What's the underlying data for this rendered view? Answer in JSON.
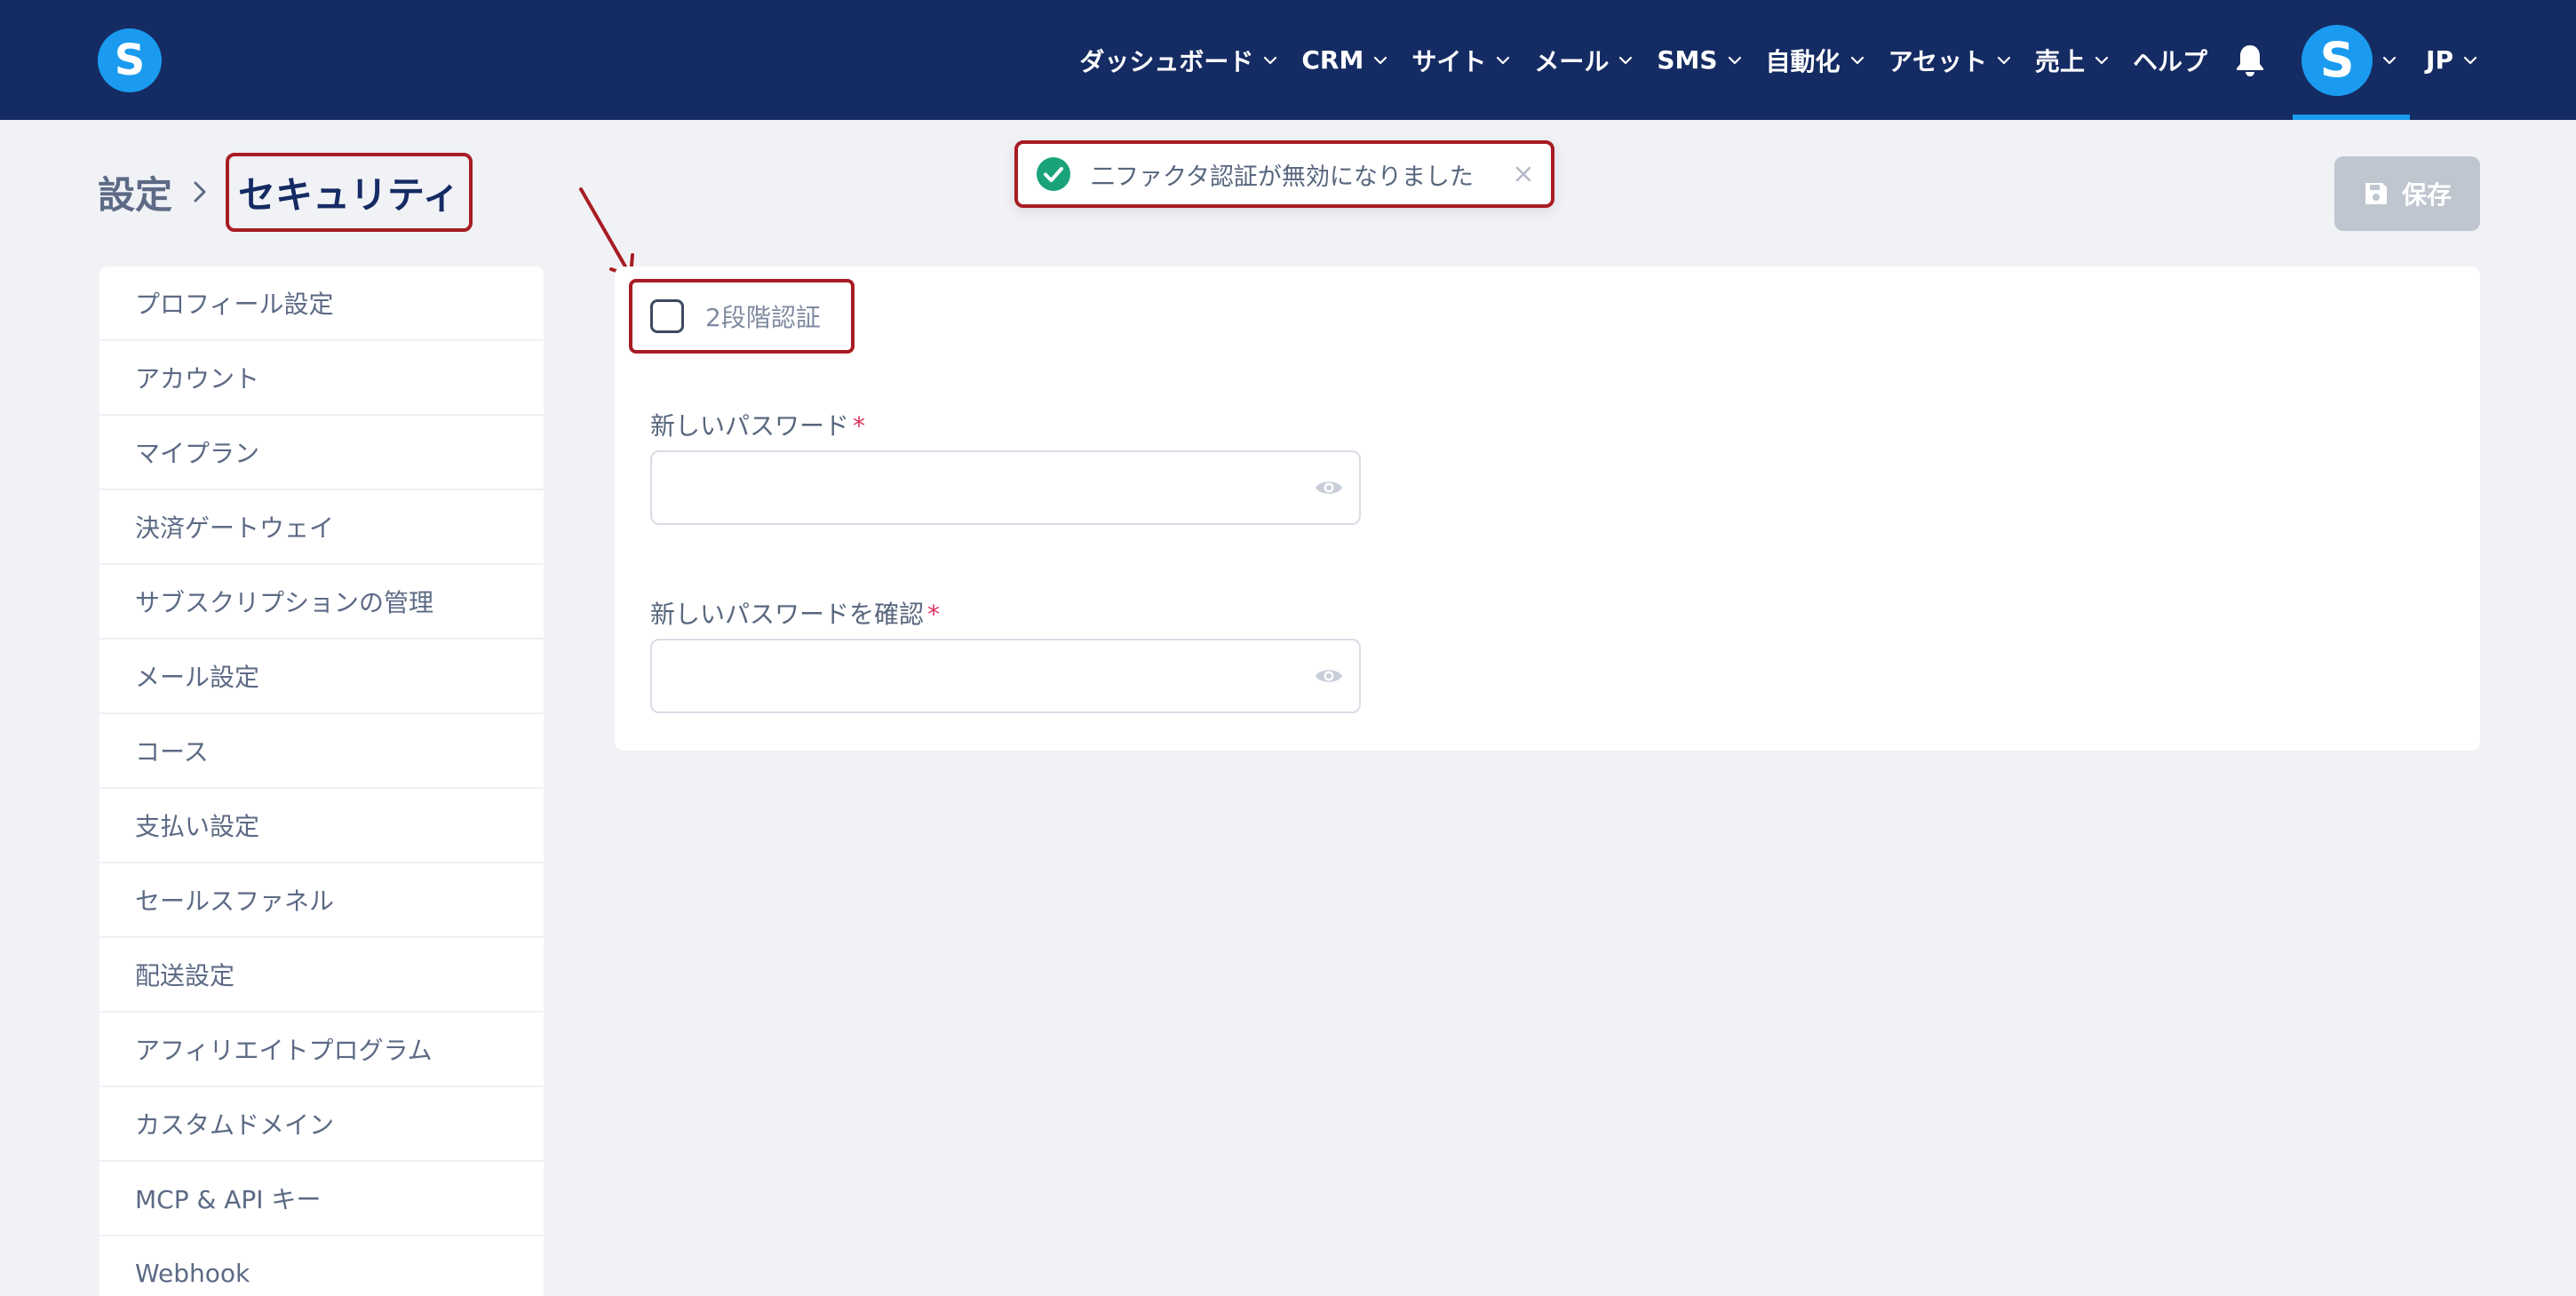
{
  "header": {
    "logo_letter": "S",
    "nav": [
      {
        "label": "ダッシュボード"
      },
      {
        "label": "CRM"
      },
      {
        "label": "サイト"
      },
      {
        "label": "メール"
      },
      {
        "label": "SMS"
      },
      {
        "label": "自動化"
      },
      {
        "label": "アセット"
      },
      {
        "label": "売上"
      },
      {
        "label": "ヘルプ"
      }
    ],
    "avatar_letter": "S",
    "language": "JP",
    "accent_color": "#1a9bef",
    "background_color": "#152b63"
  },
  "breadcrumb": {
    "root": "設定",
    "current": "セキュリティ"
  },
  "toast": {
    "message": "二ファクタ認証が無効になりました",
    "status": "success",
    "icon": "check-circle-icon"
  },
  "save_button": {
    "label": "保存",
    "icon": "floppy-disk-icon",
    "enabled": false
  },
  "sidebar": {
    "items": [
      {
        "label": "プロフィール設定"
      },
      {
        "label": "アカウント"
      },
      {
        "label": "マイプラン"
      },
      {
        "label": "決済ゲートウェイ"
      },
      {
        "label": "サブスクリプションの管理"
      },
      {
        "label": "メール設定"
      },
      {
        "label": "コース"
      },
      {
        "label": "支払い設定"
      },
      {
        "label": "セールスファネル"
      },
      {
        "label": "配送設定"
      },
      {
        "label": "アフィリエイトプログラム"
      },
      {
        "label": "カスタムドメイン"
      },
      {
        "label": "MCP & API キー"
      },
      {
        "label": "Webhook"
      }
    ]
  },
  "security": {
    "two_factor": {
      "label": "2段階認証",
      "checked": false
    },
    "new_password": {
      "label": "新しいパスワード",
      "required_mark": "*",
      "value": ""
    },
    "confirm_password": {
      "label": "新しいパスワードを確認",
      "required_mark": "*",
      "value": ""
    }
  },
  "annotation_color": "#a81c24"
}
